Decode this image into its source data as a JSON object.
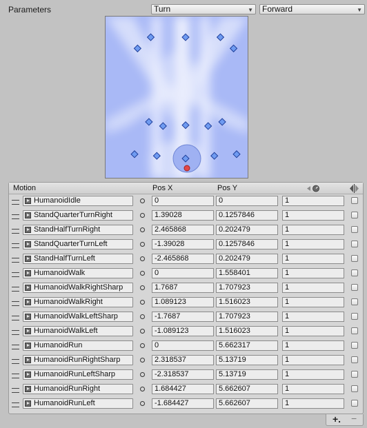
{
  "parameters_label": "Parameters",
  "param_x": "Turn",
  "param_y": "Forward",
  "columns": {
    "motion": "Motion",
    "pos_x": "Pos X",
    "pos_y": "Pos Y"
  },
  "icons": {
    "speed": "speed-icon",
    "mirror": "mirror-icon",
    "clip": "animation-clip-icon",
    "picker": "object-picker-icon",
    "handle": "drag-handle-icon"
  },
  "colors": {
    "blend_bg": "#a9b9f6",
    "node_fill": "#6f9bf1",
    "current_point": "#e24848",
    "panel_bg": "#d6d6d6"
  },
  "motions": [
    {
      "name": "HumanoidIdle",
      "pos_x": "0",
      "pos_y": "0",
      "speed": "1",
      "mirror": false
    },
    {
      "name": "StandQuarterTurnRight",
      "pos_x": "1.39028",
      "pos_y": "0.1257846",
      "speed": "1",
      "mirror": false
    },
    {
      "name": "StandHalfTurnRight",
      "pos_x": "2.465868",
      "pos_y": "0.202479",
      "speed": "1",
      "mirror": false
    },
    {
      "name": "StandQuarterTurnLeft",
      "pos_x": "-1.39028",
      "pos_y": "0.1257846",
      "speed": "1",
      "mirror": false
    },
    {
      "name": "StandHalfTurnLeft",
      "pos_x": "-2.465868",
      "pos_y": "0.202479",
      "speed": "1",
      "mirror": false
    },
    {
      "name": "HumanoidWalk",
      "pos_x": "0",
      "pos_y": "1.558401",
      "speed": "1",
      "mirror": false
    },
    {
      "name": "HumanoidWalkRightSharp",
      "pos_x": "1.7687",
      "pos_y": "1.707923",
      "speed": "1",
      "mirror": false
    },
    {
      "name": "HumanoidWalkRight",
      "pos_x": "1.089123",
      "pos_y": "1.516023",
      "speed": "1",
      "mirror": false
    },
    {
      "name": "HumanoidWalkLeftSharp",
      "pos_x": "-1.7687",
      "pos_y": "1.707923",
      "speed": "1",
      "mirror": false
    },
    {
      "name": "HumanoidWalkLeft",
      "pos_x": "-1.089123",
      "pos_y": "1.516023",
      "speed": "1",
      "mirror": false
    },
    {
      "name": "HumanoidRun",
      "pos_x": "0",
      "pos_y": "5.662317",
      "speed": "1",
      "mirror": false
    },
    {
      "name": "HumanoidRunRightSharp",
      "pos_x": "2.318537",
      "pos_y": "5.13719",
      "speed": "1",
      "mirror": false
    },
    {
      "name": "HumanoidRunLeftSharp",
      "pos_x": "-2.318537",
      "pos_y": "5.13719",
      "speed": "1",
      "mirror": false
    },
    {
      "name": "HumanoidRunRight",
      "pos_x": "1.684427",
      "pos_y": "5.662607",
      "speed": "1",
      "mirror": false
    },
    {
      "name": "HumanoidRunLeft",
      "pos_x": "-1.684427",
      "pos_y": "5.662607",
      "speed": "1",
      "mirror": false
    }
  ],
  "footer": {
    "add_label": "+.",
    "remove_label": "−"
  }
}
